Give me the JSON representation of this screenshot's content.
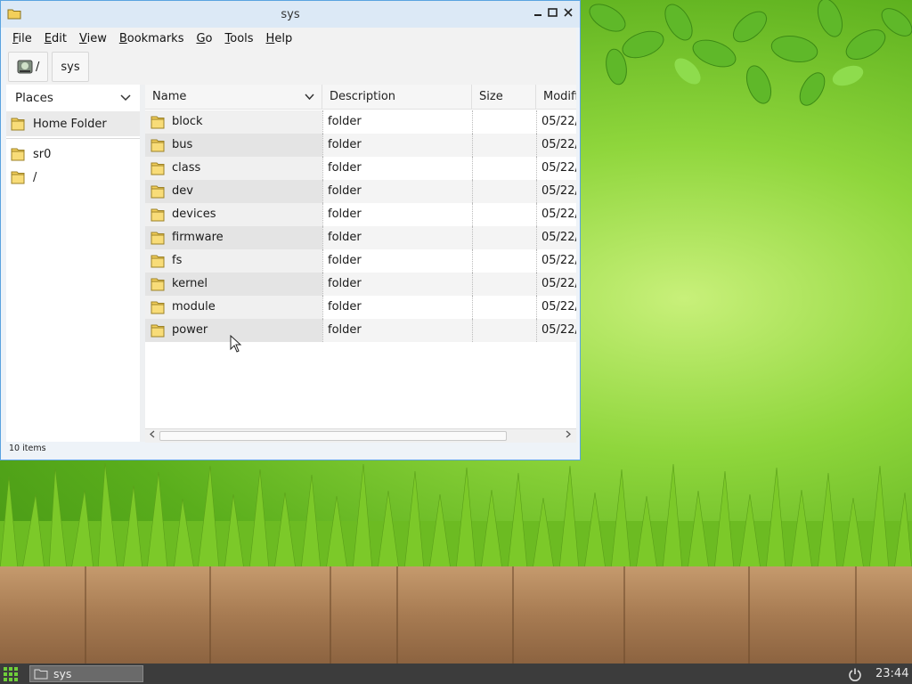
{
  "window": {
    "title": "sys",
    "menu": [
      "File",
      "Edit",
      "View",
      "Bookmarks",
      "Go",
      "Tools",
      "Help"
    ],
    "menu_underline": [
      "F",
      "E",
      "V",
      "B",
      "G",
      "T",
      "H"
    ]
  },
  "pathbar": {
    "root_label": "/",
    "current_label": "sys"
  },
  "sidebar": {
    "heading": "Places",
    "items": [
      {
        "label": "Home Folder",
        "selected": true
      },
      {
        "label": "sr0"
      },
      {
        "label": "/"
      }
    ]
  },
  "list": {
    "columns": [
      "Name",
      "Description",
      "Size",
      "Modifi"
    ],
    "rows": [
      {
        "name": "block",
        "description": "folder",
        "size": "",
        "modified": "05/22/"
      },
      {
        "name": "bus",
        "description": "folder",
        "size": "",
        "modified": "05/22/"
      },
      {
        "name": "class",
        "description": "folder",
        "size": "",
        "modified": "05/22/"
      },
      {
        "name": "dev",
        "description": "folder",
        "size": "",
        "modified": "05/22/"
      },
      {
        "name": "devices",
        "description": "folder",
        "size": "",
        "modified": "05/22/"
      },
      {
        "name": "firmware",
        "description": "folder",
        "size": "",
        "modified": "05/22/"
      },
      {
        "name": "fs",
        "description": "folder",
        "size": "",
        "modified": "05/22/"
      },
      {
        "name": "kernel",
        "description": "folder",
        "size": "",
        "modified": "05/22/"
      },
      {
        "name": "module",
        "description": "folder",
        "size": "",
        "modified": "05/22/"
      },
      {
        "name": "power",
        "description": "folder",
        "size": "",
        "modified": "05/22/"
      }
    ]
  },
  "status": {
    "text": "10 items"
  },
  "taskbar": {
    "task_label": "sys",
    "clock": "23:44"
  },
  "colors": {
    "window_border": "#5aa3e0",
    "titlebar": "#dce9f6",
    "folder_yellow": "#f3cf5a",
    "taskbar": "#3c3c3c"
  },
  "icons": {
    "title": "folder-icon",
    "path_root": "drive-icon",
    "places_toggle": "chevron-down-icon",
    "sort": "chevron-down-icon",
    "start": "grid-menu-icon",
    "power": "power-icon"
  }
}
